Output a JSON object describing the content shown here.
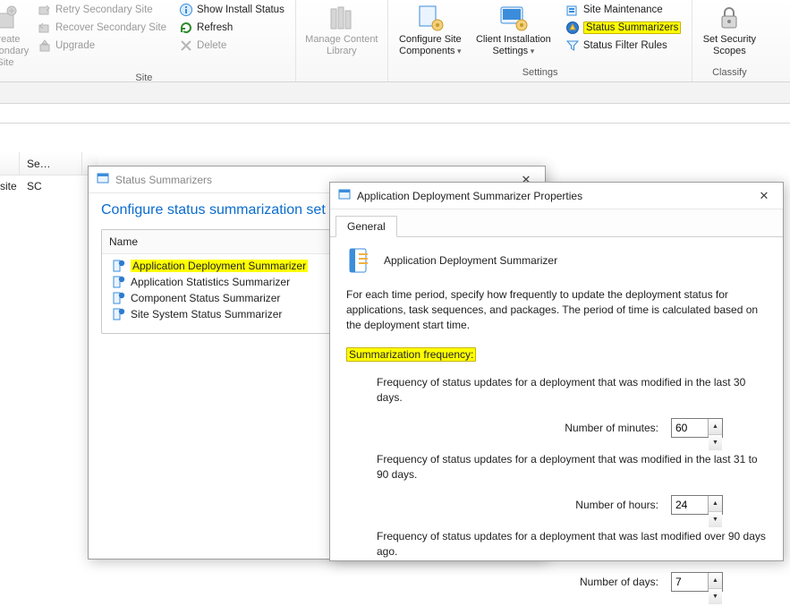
{
  "ribbon": {
    "group_site_label": "Site",
    "group_settings_label": "Settings",
    "group_classify_label": "Classify",
    "create_secondary": "Create Secondary Site",
    "retry_secondary": "Retry Secondary Site",
    "recover_secondary": "Recover Secondary Site",
    "upgrade": "Upgrade",
    "show_install": "Show Install Status",
    "refresh": "Refresh",
    "delete": "Delete",
    "manage_content": "Manage Content Library",
    "configure_site": "Configure Site Components",
    "client_install": "Client Installation Settings",
    "site_maint": "Site Maintenance",
    "status_summarizers": "Status Summarizers",
    "status_filter": "Status Filter Rules",
    "set_security": "Set Security Scopes"
  },
  "grid": {
    "col_se": "Se…",
    "row_mary": "mary site",
    "row_sc": "SC"
  },
  "win_summarizers": {
    "title": "Status Summarizers",
    "subtitle": "Configure status summarization set",
    "name_col": "Name",
    "items": [
      "Application Deployment Summarizer",
      "Application Statistics Summarizer",
      "Component Status Summarizer",
      "Site System Status Summarizer"
    ]
  },
  "win_props": {
    "title": "Application Deployment Summarizer Properties",
    "tab_general": "General",
    "heading": "Application Deployment Summarizer",
    "para": "For each time period, specify how frequently to update the deployment status for applications, task sequences, and packages. The period of time is calculated based on the deployment start time.",
    "section": "Summarization frequency:",
    "f1_desc": "Frequency of status updates for a deployment that was modified in the last 30 days.",
    "f1_label": "Number of minutes:",
    "f1_value": "60",
    "f2_desc": "Frequency of status updates for a deployment that was modified in the last 31 to 90 days.",
    "f2_label": "Number of hours:",
    "f2_value": "24",
    "f3_desc": "Frequency of status updates for a deployment that was last modified over 90 days ago.",
    "f3_label": "Number of days:",
    "f3_value": "7"
  }
}
